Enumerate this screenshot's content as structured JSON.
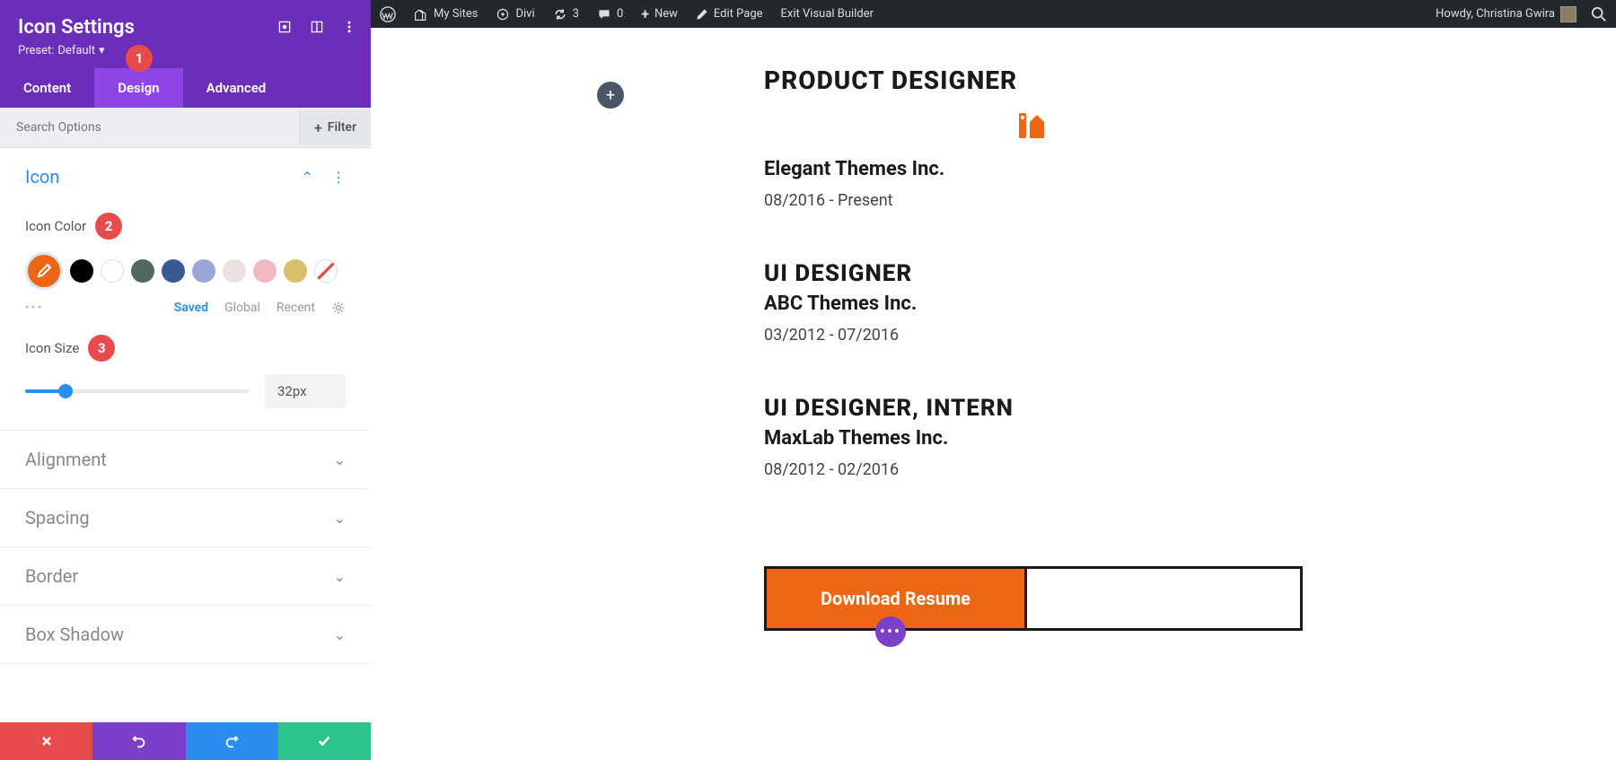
{
  "admin_bar": {
    "my_sites": "My Sites",
    "divi": "Divi",
    "updates": "3",
    "comments": "0",
    "new": "New",
    "edit_page": "Edit Page",
    "exit_vb": "Exit Visual Builder",
    "howdy": "Howdy, Christina Gwira"
  },
  "panel": {
    "title": "Icon Settings",
    "preset_label": "Preset:",
    "preset_value": "Default",
    "tabs": {
      "content": "Content",
      "design": "Design",
      "advanced": "Advanced"
    },
    "search_placeholder": "Search Options",
    "filter": "Filter",
    "sections": {
      "icon": "Icon",
      "alignment": "Alignment",
      "spacing": "Spacing",
      "border": "Border",
      "box_shadow": "Box Shadow"
    },
    "icon_color_label": "Icon Color",
    "icon_size_label": "Icon Size",
    "icon_size_value": "32px",
    "palette_tabs": {
      "saved": "Saved",
      "global": "Global",
      "recent": "Recent"
    },
    "swatches": [
      "#ec6616",
      "#000000",
      "#ffffff",
      "#526760",
      "#3a5a94",
      "#9aa6d8",
      "#e9d7d7",
      "#f0b9c3",
      "#d9bf6a"
    ]
  },
  "badges": {
    "b1": "1",
    "b2": "2",
    "b3": "3"
  },
  "canvas": {
    "job0_title": "PRODUCT DESIGNER",
    "job0_company": "Elegant Themes Inc.",
    "job0_dates": "08/2016 - Present",
    "job1_title": "UI DESIGNER",
    "job1_company": "ABC Themes Inc.",
    "job1_dates": "03/2012 - 07/2016",
    "job2_title": "UI DESIGNER, INTERN",
    "job2_company": "MaxLab Themes Inc.",
    "job2_dates": "08/2012 - 02/2016",
    "download": "Download Resume",
    "accent": "#ec6616"
  }
}
